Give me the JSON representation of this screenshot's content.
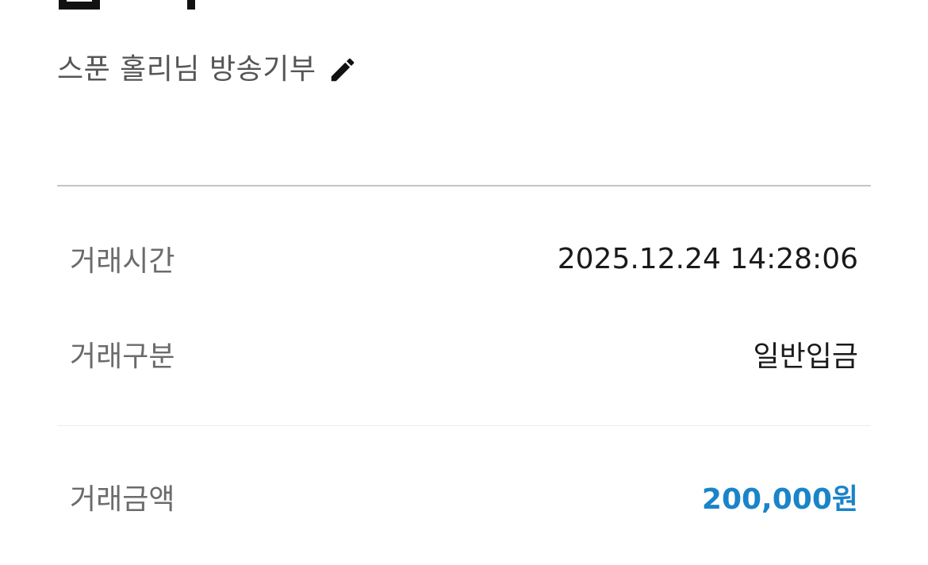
{
  "memo": {
    "text": "스푼 홀리님 방송기부",
    "edit_icon": "pencil-icon"
  },
  "details": {
    "transaction_time": {
      "label": "거래시간",
      "value": "2025.12.24 14:28:06"
    },
    "transaction_type": {
      "label": "거래구분",
      "value": "일반입금"
    },
    "transaction_amount": {
      "label": "거래금액",
      "value": "200,000원",
      "color": "#1a84c8"
    }
  }
}
